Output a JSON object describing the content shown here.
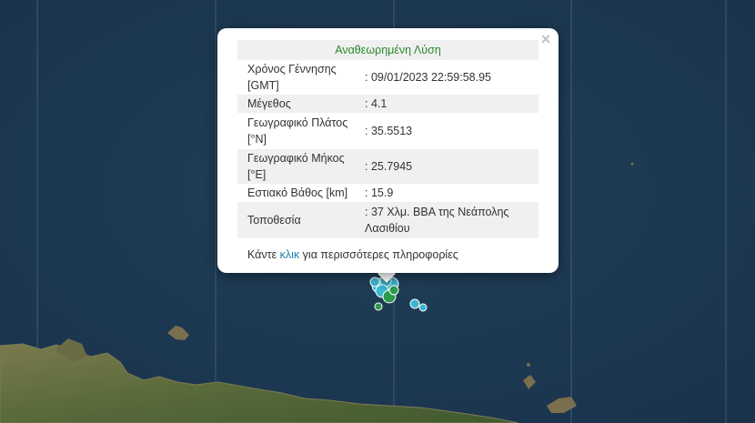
{
  "popup": {
    "title": "Αναθεωρημένη Λύση",
    "close_symbol": "×",
    "rows": [
      {
        "label": "Χρόνος Γέννησης [GMT]",
        "value": ": 09/01/2023 22:59:58.95"
      },
      {
        "label": "Μέγεθος",
        "value": ": 4.1"
      },
      {
        "label": "Γεωγραφικό Πλάτος [°N]",
        "value": ": 35.5513"
      },
      {
        "label": "Γεωγραφικό Μήκος [°E]",
        "value": ": 25.7945"
      },
      {
        "label": "Εστιακό Βάθος [km]",
        "value": ": 15.9"
      },
      {
        "label": "Τοποθεσία",
        "value": ": 37 Χλμ. ΒΒΑ της Νεάπολης Λασιθίου"
      }
    ],
    "footer": {
      "prefix": "Κάντε ",
      "link": "κλικ",
      "suffix": " για περισσότερες πληροφορίες"
    }
  },
  "colors": {
    "sea": "#1f3a52",
    "land": "#5d6b3f",
    "title_green": "#2a8a2a",
    "link_blue": "#1f7fa8",
    "marker_cyan": "#3ab8d0",
    "marker_green": "#2e9a4c"
  },
  "map": {
    "markers": [
      {
        "type": "cyan"
      },
      {
        "type": "cyan"
      },
      {
        "type": "cyan"
      },
      {
        "type": "cyan"
      },
      {
        "type": "cyan"
      },
      {
        "type": "green"
      },
      {
        "type": "green"
      },
      {
        "type": "green"
      },
      {
        "type": "cyan"
      },
      {
        "type": "cyan"
      }
    ]
  }
}
